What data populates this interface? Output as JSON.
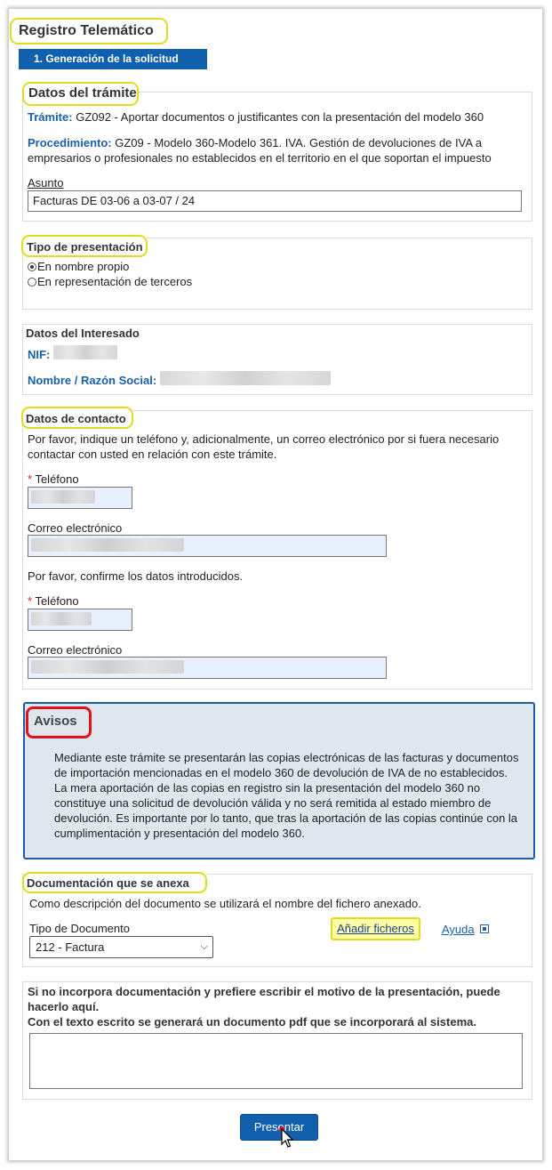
{
  "header": {
    "title": "Registro Telemático",
    "step": "1. Generación de la solicitud"
  },
  "tramite": {
    "section_title": "Datos del trámite",
    "tramite_label": "Trámite:",
    "tramite_value": "GZ092 - Aportar documentos o justificantes con la presentación del modelo 360",
    "procedimiento_label": "Procedimiento:",
    "procedimiento_value_1": "GZ09 - Modelo 360-Modelo 361. IVA. Gestión de devoluciones de IVA a",
    "procedimiento_value_2": "empresarios o profesionales no establecidos en el territorio en el que soportan el impuesto",
    "asunto_label": "Asunto",
    "asunto_value": "Facturas DE 03-06 a 03-07 / 24"
  },
  "presentacion": {
    "section_title": "Tipo de presentación",
    "options": [
      "En nombre propio",
      "En representación de terceros"
    ],
    "selected": "En nombre propio"
  },
  "interesado": {
    "section_title": "Datos del Interesado",
    "nif_label": "NIF:",
    "nombre_label": "Nombre / Razón Social:"
  },
  "contacto": {
    "section_title": "Datos de contacto",
    "intro_1": "Por favor, indique un teléfono y, adicionalmente, un correo electrónico por si fuera necesario",
    "intro_2": "contactar con usted en relación con este trámite.",
    "telefono_label": "Teléfono",
    "correo_label": "Correo electrónico",
    "confirm_text": "Por favor, confirme los datos introducidos.",
    "required_mark": "*"
  },
  "avisos": {
    "title": "Avisos",
    "lines": [
      "Mediante este trámite se presentarán las copias electrónicas de las facturas y documentos",
      "de importación mencionadas en el modelo 360 de devolución de IVA de no establecidos.",
      "La mera aportación de las copias en registro sin la presentación del modelo 360 no",
      "constituye una solicitud de devolución válida y no será remitida al estado miembro de",
      "devolución. Es importante por lo tanto, que tras la aportación de las copias continúe con la",
      "cumplimentación y presentación del modelo 360."
    ]
  },
  "documentacion": {
    "section_title": "Documentación que se anexa",
    "description": "Como descripción del documento se utilizará el nombre del fichero anexado.",
    "tipo_label": "Tipo de Documento",
    "tipo_value": "212 - Factura",
    "add_button": "Añadir ficheros",
    "help_link": "Ayuda"
  },
  "motivo": {
    "line_1": "Si no incorpora documentación y prefiere escribir el motivo de la presentación, puede",
    "line_2": "hacerlo aquí.",
    "line_3": "Con el texto escrito se generará un documento pdf que se incorporará al sistema."
  },
  "submit_label": "Presentar",
  "colors": {
    "primary": "#1060ad",
    "highlight": "#e3dc1e",
    "alert_border": "#e0121b",
    "notice_bg": "#dfe6ee"
  }
}
